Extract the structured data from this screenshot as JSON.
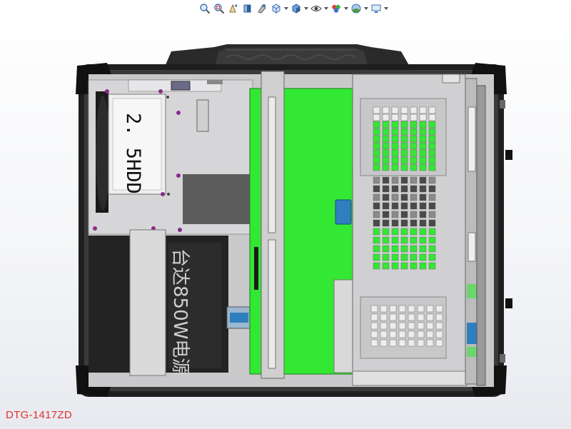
{
  "toolbar": {
    "icons": [
      "zoom-to-fit-icon",
      "zoom-area-icon",
      "previous-view-icon",
      "section-view-icon",
      "dynamic-annotation-icon",
      "view-orientation-icon",
      "display-style-icon",
      "hide-show-items-icon",
      "edit-appearance-icon",
      "apply-scene-icon",
      "view-settings-icon"
    ]
  },
  "model": {
    "hdd_label": "2. 5HDD",
    "psu_label": "台达850W电源",
    "name": "DTG-1417ZD"
  },
  "colors": {
    "pcb_green": "#33e833",
    "chassis_frame": "#1e1e1e",
    "panel_gray": "#d8d8da",
    "label_red": "#e0322c",
    "blue_tab": "#2f7fbf"
  }
}
